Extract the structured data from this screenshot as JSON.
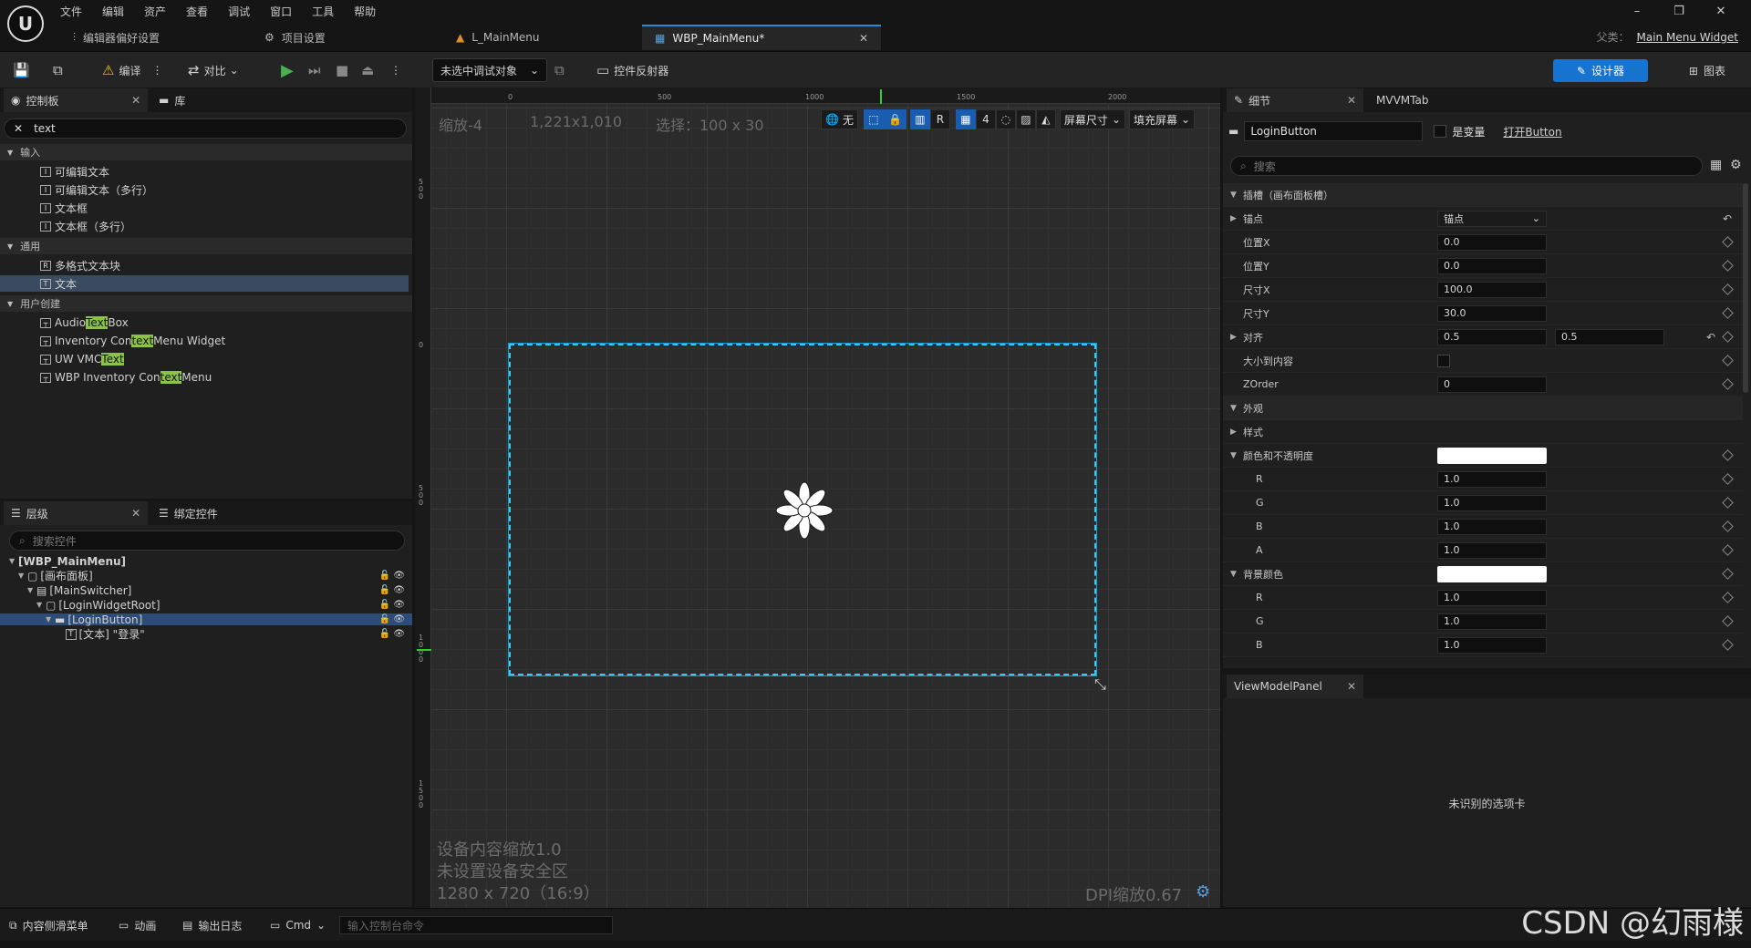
{
  "menu": [
    "文件",
    "编辑",
    "资产",
    "查看",
    "调试",
    "窗口",
    "工具",
    "帮助"
  ],
  "logo": "U",
  "tabs": {
    "editor_prefs": "编辑器偏好设置",
    "project_settings": "项目设置",
    "level": "L_MainMenu",
    "widget": "WBP_MainMenu*"
  },
  "parent_class": {
    "label": "父类：",
    "value": "Main Menu Widget"
  },
  "toolbar": {
    "compile": "编译",
    "diff": "对比",
    "debug_target": "未选中调试对象",
    "widget_reflector": "控件反射器",
    "designer": "设计器",
    "graph": "图表"
  },
  "palette": {
    "tab_palette": "控制板",
    "tab_library": "库",
    "search_value": "text",
    "categories": [
      {
        "name": "输入",
        "items": [
          "可编辑文本",
          "可编辑文本（多行）",
          "文本框",
          "文本框（多行）"
        ]
      },
      {
        "name": "通用",
        "items": [
          "多格式文本块",
          "文本"
        ]
      },
      {
        "name": "用户创建",
        "items": []
      }
    ],
    "user_items": [
      {
        "pre": "Audio ",
        "hl": "Text",
        "post": " Box"
      },
      {
        "pre": "Inventory Con",
        "hl": "text",
        "post": " Menu Widget"
      },
      {
        "pre": "UW VMC",
        "hl": "Text",
        "post": ""
      },
      {
        "pre": "WBP Inventory Con",
        "hl": "text",
        "post": " Menu"
      }
    ]
  },
  "hierarchy": {
    "tab_hierarchy": "层级",
    "tab_bind": "绑定控件",
    "search_placeholder": "搜索控件",
    "rows": [
      "[WBP_MainMenu]",
      "[画布面板]",
      "[MainSwitcher]",
      "[LoginWidgetRoot]",
      "[LoginButton]",
      "[文本] \"登录\""
    ]
  },
  "viewport": {
    "zoom": "缩放-4",
    "resolution": "1,221x1,010",
    "selection": "选择：100 x 30",
    "ruler_top": [
      "0",
      "500",
      "1000",
      "1500",
      "2000"
    ],
    "ruler_left": [
      "5\n0\n0",
      "0",
      "5\n0\n0",
      "1\n0\n0\n0",
      "1\n5\n0\n0"
    ],
    "btn_none": "无",
    "btn_r": "R",
    "grid_num": "4",
    "screen_size": "屏幕尺寸",
    "fill_screen": "填充屏幕",
    "device_scale": "设备内容缩放1.0",
    "safe_zone": "未设置设备安全区",
    "screen_res": "1280 x 720（16:9）",
    "dpi": "DPI缩放0.67"
  },
  "details": {
    "tab_details": "细节",
    "tab_mvvm": "MVVMTab",
    "widget_name": "LoginButton",
    "is_variable": "是变量",
    "open_link": "打开Button",
    "search_placeholder": "搜索",
    "slot_header": "插槽（画布面板槽）",
    "anchor_label": "锚点",
    "anchor_value": "锚点",
    "pos_x_label": "位置X",
    "pos_x": "0.0",
    "pos_y_label": "位置Y",
    "pos_y": "0.0",
    "size_x_label": "尺寸X",
    "size_x": "100.0",
    "size_y_label": "尺寸Y",
    "size_y": "30.0",
    "align_label": "对齐",
    "align_x": "0.5",
    "align_y": "0.5",
    "size_to_content": "大小到内容",
    "zorder_label": "ZOrder",
    "zorder": "0",
    "appearance": "外观",
    "style": "样式",
    "color_opacity": "颜色和不透明度",
    "r_label": "R",
    "r": "1.0",
    "g_label": "G",
    "g": "1.0",
    "b_label": "B",
    "b": "1.0",
    "a_label": "A",
    "a": "1.0",
    "bg_color": "背景颜色",
    "bg_r": "1.0",
    "bg_g": "1.0",
    "bg_b": "1.0"
  },
  "viewmodel": {
    "tab": "ViewModelPanel",
    "message": "未识别的选项卡"
  },
  "statusbar": {
    "content_drawer": "内容侧滑菜单",
    "animation": "动画",
    "output_log": "输出日志",
    "cmd": "Cmd",
    "console_placeholder": "输入控制台命令"
  },
  "watermark": "CSDN @幻雨様"
}
